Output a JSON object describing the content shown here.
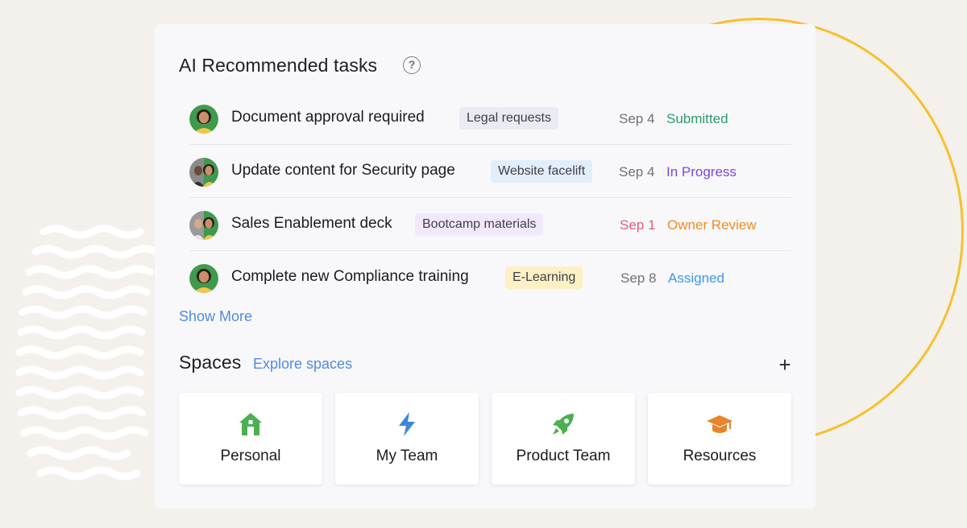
{
  "recommended": {
    "title": "AI Recommended tasks",
    "help_icon": "question-circle-icon",
    "tasks": [
      {
        "title": "Document approval required",
        "tag": "Legal requests",
        "date": "Sep 4",
        "status": "Submitted",
        "tag_bg": "#ebebf3",
        "date_color": "#6f6f78",
        "status_color": "#2e9a6a",
        "avatar": "avatar-woman-icon"
      },
      {
        "title": "Update content for Security page",
        "tag": "Website facelift",
        "date": "Sep 4",
        "status": "In Progress",
        "tag_bg": "#e3eefc",
        "date_color": "#6f6f78",
        "status_color": "#7b44e0",
        "avatar": "avatar-group-icon"
      },
      {
        "title": "Sales Enablement deck",
        "tag": "Bootcamp materials",
        "date": "Sep 1",
        "status": "Owner Review",
        "tag_bg": "#f1e9fb",
        "date_color": "#e65a78",
        "status_color": "#ef8b1f",
        "avatar": "avatar-pair-icon"
      },
      {
        "title": "Complete new Compliance training",
        "tag": "E-Learning",
        "date": "Sep 8",
        "status": "Assigned",
        "tag_bg": "#fdf0c4",
        "date_color": "#6f6f78",
        "status_color": "#3c98e8",
        "avatar": "avatar-woman-icon"
      }
    ],
    "show_more": "Show More"
  },
  "spaces": {
    "title": "Spaces",
    "explore_link": "Explore spaces",
    "add_icon": "plus-icon",
    "items": [
      {
        "label": "Personal",
        "icon": "home-icon",
        "color": "#4caf50"
      },
      {
        "label": "My Team",
        "icon": "lightning-icon",
        "color": "#3c87d8"
      },
      {
        "label": "Product Team",
        "icon": "rocket-icon",
        "color": "#4caf50"
      },
      {
        "label": "Resources",
        "icon": "graduation-cap-icon",
        "color": "#e8842a"
      }
    ]
  }
}
